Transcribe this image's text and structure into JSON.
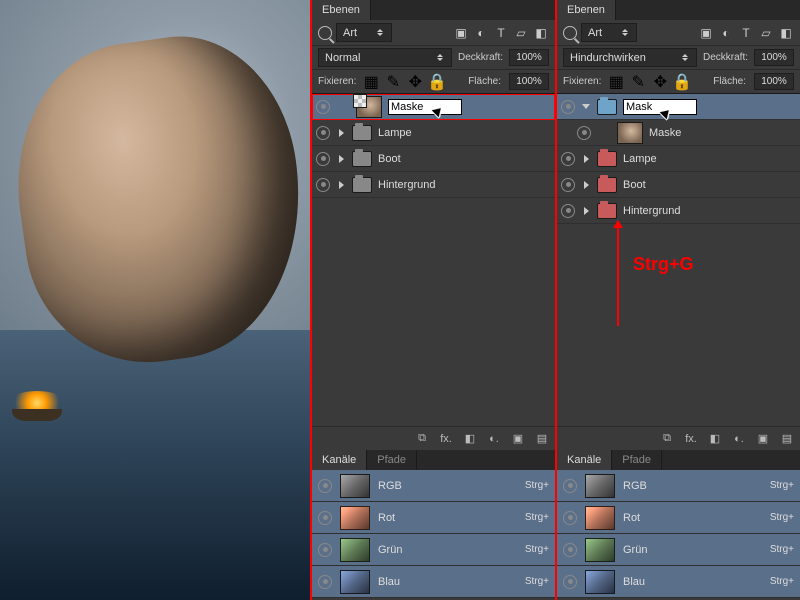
{
  "panels": {
    "left": {
      "tab_layers": "Ebenen",
      "filter_label": "Art",
      "blend_mode": "Normal",
      "opacity_label": "Deckkraft:",
      "opacity_value": "100%",
      "lock_label": "Fixieren:",
      "fill_label": "Fläche:",
      "fill_value": "100%",
      "rename_value": "Maske",
      "layers": [
        {
          "name": "Lampe"
        },
        {
          "name": "Boot"
        },
        {
          "name": "Hintergrund"
        }
      ],
      "channels_tab": "Kanäle",
      "paths_tab": "Pfade",
      "channels": [
        {
          "name": "RGB",
          "shortcut": "Strg+"
        },
        {
          "name": "Rot",
          "shortcut": "Strg+"
        },
        {
          "name": "Grün",
          "shortcut": "Strg+"
        },
        {
          "name": "Blau",
          "shortcut": "Strg+"
        }
      ]
    },
    "right": {
      "tab_layers": "Ebenen",
      "filter_label": "Art",
      "blend_mode": "Hindurchwirken",
      "opacity_label": "Deckkraft:",
      "opacity_value": "100%",
      "lock_label": "Fixieren:",
      "fill_label": "Fläche:",
      "fill_value": "100%",
      "rename_value": "Mask",
      "layers": [
        {
          "name": "Maske"
        },
        {
          "name": "Lampe"
        },
        {
          "name": "Boot"
        },
        {
          "name": "Hintergrund"
        }
      ],
      "channels_tab": "Kanäle",
      "paths_tab": "Pfade",
      "channels": [
        {
          "name": "RGB",
          "shortcut": "Strg+"
        },
        {
          "name": "Rot",
          "shortcut": "Strg+"
        },
        {
          "name": "Grün",
          "shortcut": "Strg+"
        },
        {
          "name": "Blau",
          "shortcut": "Strg+"
        }
      ]
    }
  },
  "annotation": "Strg+G",
  "icons": {
    "image": "▣",
    "fx": "fx",
    "mask": "◧",
    "adjust": "◐",
    "group": "▣",
    "new": "▤",
    "trash": "🗑",
    "checker": "▦",
    "brush": "✎",
    "move": "✥",
    "lock": "🔒",
    "text": "T",
    "shape": "▭",
    "filter": "▾",
    "link": "⧉"
  }
}
